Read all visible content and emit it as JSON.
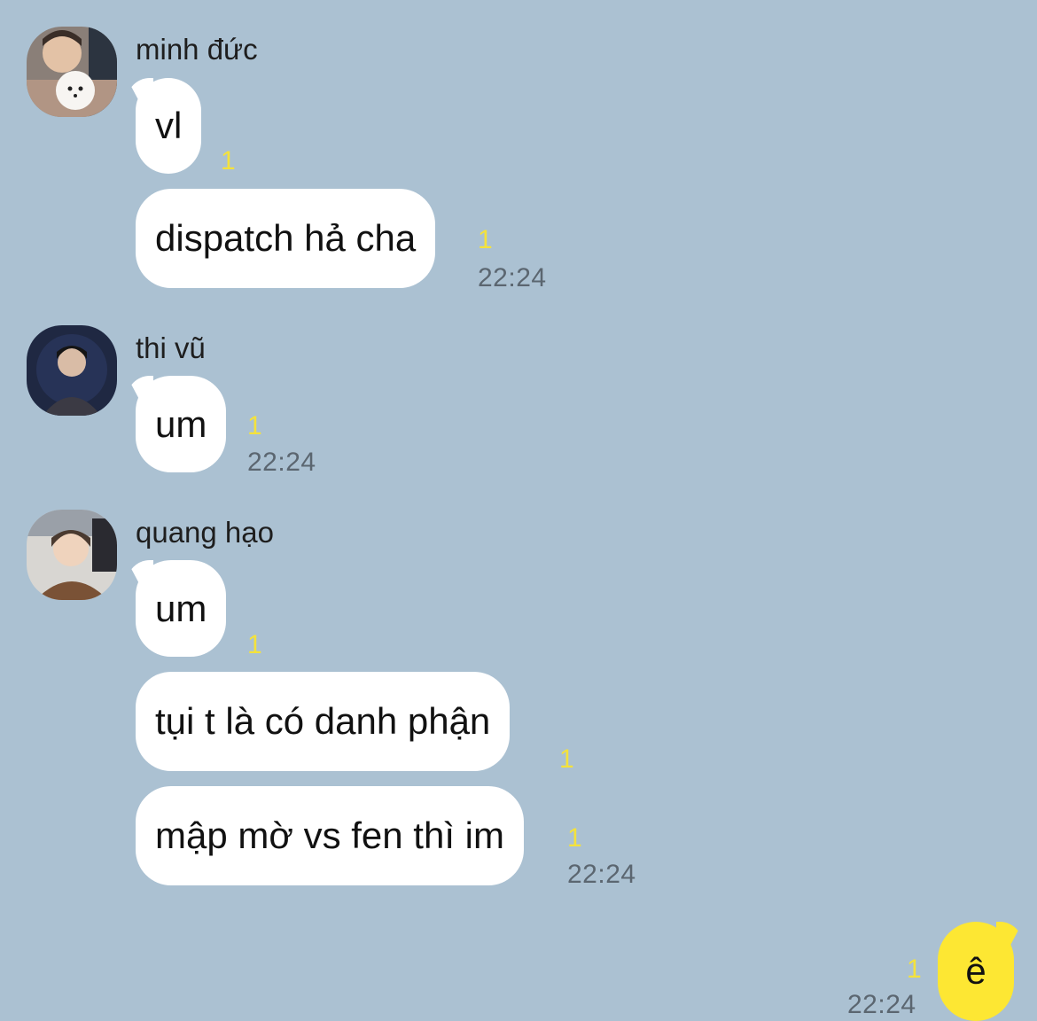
{
  "colors": {
    "background": "#abc1d2",
    "incoming_bubble": "#ffffff",
    "outgoing_bubble": "#fde733",
    "unread": "#f4e23c",
    "timestamp": "#5b6670"
  },
  "groups": [
    {
      "sender": "minh đức",
      "avatar_icon": "avatar-photo-icon",
      "messages": [
        {
          "text": "vl",
          "unread": "1"
        },
        {
          "text": "dispatch hả cha",
          "unread": "1"
        }
      ],
      "time": "22:24"
    },
    {
      "sender": "thi vũ",
      "avatar_icon": "avatar-photo-icon",
      "messages": [
        {
          "text": "um",
          "unread": "1"
        }
      ],
      "time": "22:24"
    },
    {
      "sender": "quang hạo",
      "avatar_icon": "avatar-photo-icon",
      "messages": [
        {
          "text": "um",
          "unread": "1"
        },
        {
          "text": "tụi t là có danh phận",
          "unread": "1"
        },
        {
          "text": "mập mờ vs fen thì im",
          "unread": "1"
        }
      ],
      "time": "22:24"
    }
  ],
  "my_message": {
    "text": "ê",
    "unread": "1",
    "time": "22:24"
  }
}
